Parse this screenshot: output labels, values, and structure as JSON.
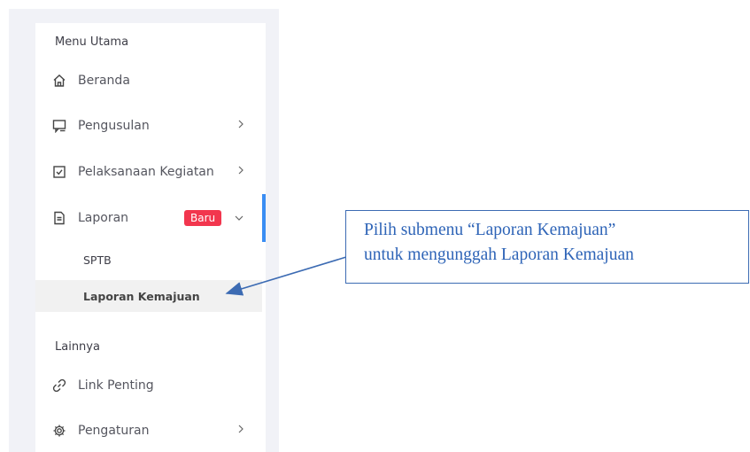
{
  "sidebar": {
    "section_main": "Menu Utama",
    "section_other": "Lainnya",
    "items": {
      "beranda": "Beranda",
      "pengusulan": "Pengusulan",
      "pelaksanaan": "Pelaksanaan Kegiatan",
      "laporan": "Laporan",
      "laporan_badge": "Baru",
      "link_penting": "Link Penting",
      "pengaturan": "Pengaturan"
    },
    "submenu": {
      "sptb": "SPTB",
      "laporan_kemajuan": "Laporan Kemajuan"
    }
  },
  "callout": {
    "line1": "Pilih submenu “Laporan Kemajuan”",
    "line2": "untuk mengunggah Laporan Kemajuan"
  },
  "colors": {
    "active_bar": "#3a8df3",
    "badge": "#f2364e",
    "callout": "#2e64b7"
  },
  "icons": [
    "home-icon",
    "comment-icon",
    "checkbox-icon",
    "document-icon",
    "link-icon",
    "gear-icon",
    "chevron-right-icon",
    "chevron-down-icon"
  ]
}
